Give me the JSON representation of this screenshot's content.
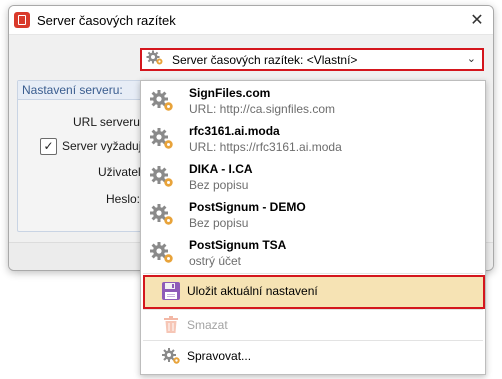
{
  "window": {
    "title": "Server časových razítek",
    "close_symbol": "✕"
  },
  "combo": {
    "label": "Server časových razítek:  <Vlastní>",
    "chevron": "⌄"
  },
  "settings_group": {
    "title": "Nastavení serveru:",
    "url_label": "URL serveru:",
    "auth_checkbox_label": "Server vyžaduje",
    "auth_checked": true,
    "user_label": "Uživatel:",
    "password_label": "Heslo:"
  },
  "popup": {
    "servers": [
      {
        "name": "SignFiles.com",
        "desc": "URL: http://ca.signfiles.com"
      },
      {
        "name": "rfc3161.ai.moda",
        "desc": "URL: https://rfc3161.ai.moda"
      },
      {
        "name": "DIKA - I.CA",
        "desc": "Bez popisu"
      },
      {
        "name": "PostSignum - DEMO",
        "desc": "Bez popisu"
      },
      {
        "name": "PostSignum TSA",
        "desc": "ostrý účet"
      }
    ],
    "save_label": "Uložit aktuální nastavení",
    "delete_label": "Smazat",
    "manage_label": "Spravovat..."
  },
  "colors": {
    "highlight_border": "#d4161d",
    "save_background": "#f6e3b4",
    "gear_gray": "#8a8a8a",
    "gear_orange": "#e8a33a",
    "disabled_text": "#a3a3a3"
  },
  "icons": {
    "app": "pdf-app-icon",
    "server": "gear-icon",
    "save": "floppy-disk-icon",
    "delete": "trash-icon",
    "manage": "gear-icon"
  }
}
